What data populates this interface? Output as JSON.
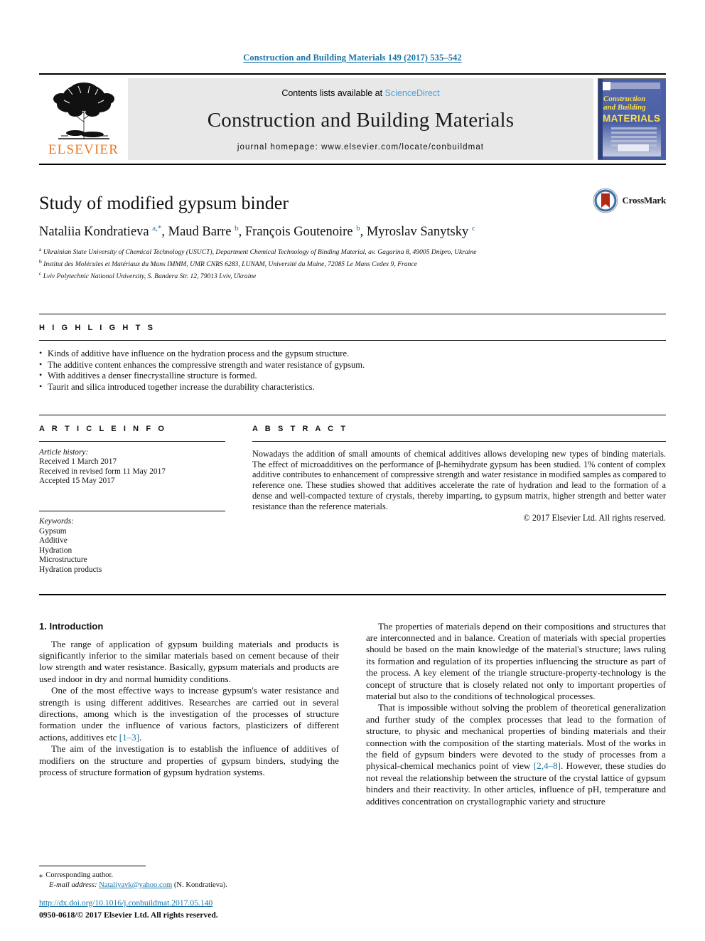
{
  "running_head": "Construction and Building Materials 149 (2017) 535–542",
  "masthead": {
    "publisher_name": "ELSEVIER",
    "contents_prefix": "Contents lists available at ",
    "contents_link": "ScienceDirect",
    "journal_title": "Construction and Building Materials",
    "homepage": "journal homepage: www.elsevier.com/locate/conbuildmat",
    "cover": {
      "line1": "Construction",
      "line2": "and Building",
      "line3": "MATERIALS"
    }
  },
  "crossmark": {
    "label": "CrossMark"
  },
  "article": {
    "title": "Study of modified gypsum binder",
    "authors_html": "Nataliia Kondratieva <sup>a,*</sup>, Maud Barre <sup>b</sup>, François Goutenoire <sup>b</sup>, Myroslav Sanytsky <sup>c</sup>",
    "affiliations": [
      "Ukrainian State University of Chemical Technology (USUCT), Department Chemical Technology of Binding Material, av. Gagarina 8, 49005 Dnipro, Ukraine",
      "Institut des Molécules et Matériaux du Mans IMMM, UMR CNRS 6283, LUNAM, Université du Maine, 72085 Le Mans Cedex 9, France",
      "Lviv Polytechnic National University, S. Bandera Str. 12, 79013 Lviv, Ukraine"
    ],
    "affiliation_markers": [
      "a",
      "b",
      "c"
    ]
  },
  "highlights": {
    "label": "H I G H L I G H T S",
    "items": [
      "Kinds of additive have influence on the hydration process and the gypsum structure.",
      "The additive content enhances the compressive strength and water resistance of gypsum.",
      "With additives a denser finecrystalline structure is formed.",
      "Taurit and silica introduced together increase the durability characteristics."
    ]
  },
  "article_info": {
    "label": "A R T I C L E    I N F O",
    "history_label": "Article history:",
    "history": [
      "Received 1 March 2017",
      "Received in revised form 11 May 2017",
      "Accepted 15 May 2017"
    ],
    "keywords_label": "Keywords:",
    "keywords": [
      "Gypsum",
      "Additive",
      "Hydration",
      "Microstructure",
      "Hydration products"
    ]
  },
  "abstract": {
    "label": "A B S T R A C T",
    "text": "Nowadays the addition of small amounts of chemical additives allows developing new types of binding materials. The effect of microadditives on the performance of β-hemihydrate gypsum has been studied. 1% content of complex additive contributes to enhancement of compressive strength and water resistance in modified samples as compared to reference one. These studies showed that additives accelerate the rate of hydration and lead to the formation of a dense and well-compacted texture of crystals, thereby imparting, to gypsum matrix, higher strength and better water resistance than the reference materials.",
    "copyright": "© 2017 Elsevier Ltd. All rights reserved."
  },
  "body": {
    "section_number_title": "1. Introduction",
    "left_paragraphs": [
      "The range of application of gypsum building materials and products is significantly inferior to the similar materials based on cement because of their low strength and water resistance. Basically, gypsum materials and products are used indoor in dry and normal humidity conditions.",
      "One of the most effective ways to increase gypsum's water resistance and strength is using different additives. Researches are carried out in several directions, among which is the investigation of the processes of structure formation under the influence of various factors, plasticizers of different actions, additives etc ",
      "The aim of the investigation is to establish the influence of additives of modifiers on the structure and properties of gypsum binders, studying the process of structure formation of gypsum hydration systems."
    ],
    "left_ref_1": "[1–3]",
    "right_paragraphs": [
      "The properties of materials depend on their compositions and structures that are interconnected and in balance. Creation of materials with special properties should be based on the main knowledge of the material's structure; laws ruling its formation and regulation of its properties influencing the structure as part of the process. A key element of the triangle structure-property-technology is the concept of structure that is closely related not only to important properties of material but also to the conditions of technological processes.",
      "That is impossible without solving the problem of theoretical generalization and further study of the complex processes that lead to the formation of structure, to physic and mechanical properties of binding materials and their connection with the composition of the starting materials. Most of the works in the field of gypsum binders were devoted to the study of processes from a physical-chemical mechanics point of view ",
      "However, these studies do not reveal the relationship between the structure of the crystal lattice of gypsum binders and their reactivity. In other articles, influence of pH, temperature and additives concentration on crystallographic variety and structure"
    ],
    "right_ref_1": "[2,4–8]"
  },
  "footnote": {
    "corresponding_marker": "⁎",
    "corresponding_text": "Corresponding author.",
    "email_label": "E-mail address:",
    "email": "Nataliyavk@yahoo.com",
    "email_owner": "(N. Kondratieva)."
  },
  "footer": {
    "doi": "http://dx.doi.org/10.1016/j.conbuildmat.2017.05.140",
    "issn_line": "0950-0618/© 2017 Elsevier Ltd. All rights reserved."
  },
  "colors": {
    "link_blue": "#1a74a8",
    "sciencedirect_blue": "#4aa3d8",
    "elsevier_orange": "#e87722",
    "band_grey": "#e8e8e8",
    "cover_blue": "#4a5fa5",
    "cover_yellow": "#ffe14d"
  }
}
